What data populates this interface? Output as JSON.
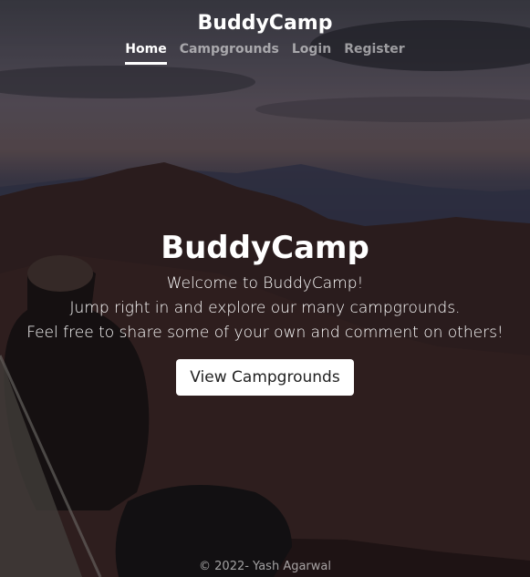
{
  "nav": {
    "brand": "BuddyCamp",
    "links": [
      {
        "label": "Home"
      },
      {
        "label": "Campgrounds"
      },
      {
        "label": "Login"
      },
      {
        "label": "Register"
      }
    ]
  },
  "hero": {
    "title": "BuddyCamp",
    "lines": [
      "Welcome to BuddyCamp!",
      "Jump right in and explore our many campgrounds.",
      "Feel free to share some of your own and comment on others!"
    ],
    "button_label": "View Campgrounds"
  },
  "footer": {
    "text": "© 2022- Yash Agarwal"
  }
}
